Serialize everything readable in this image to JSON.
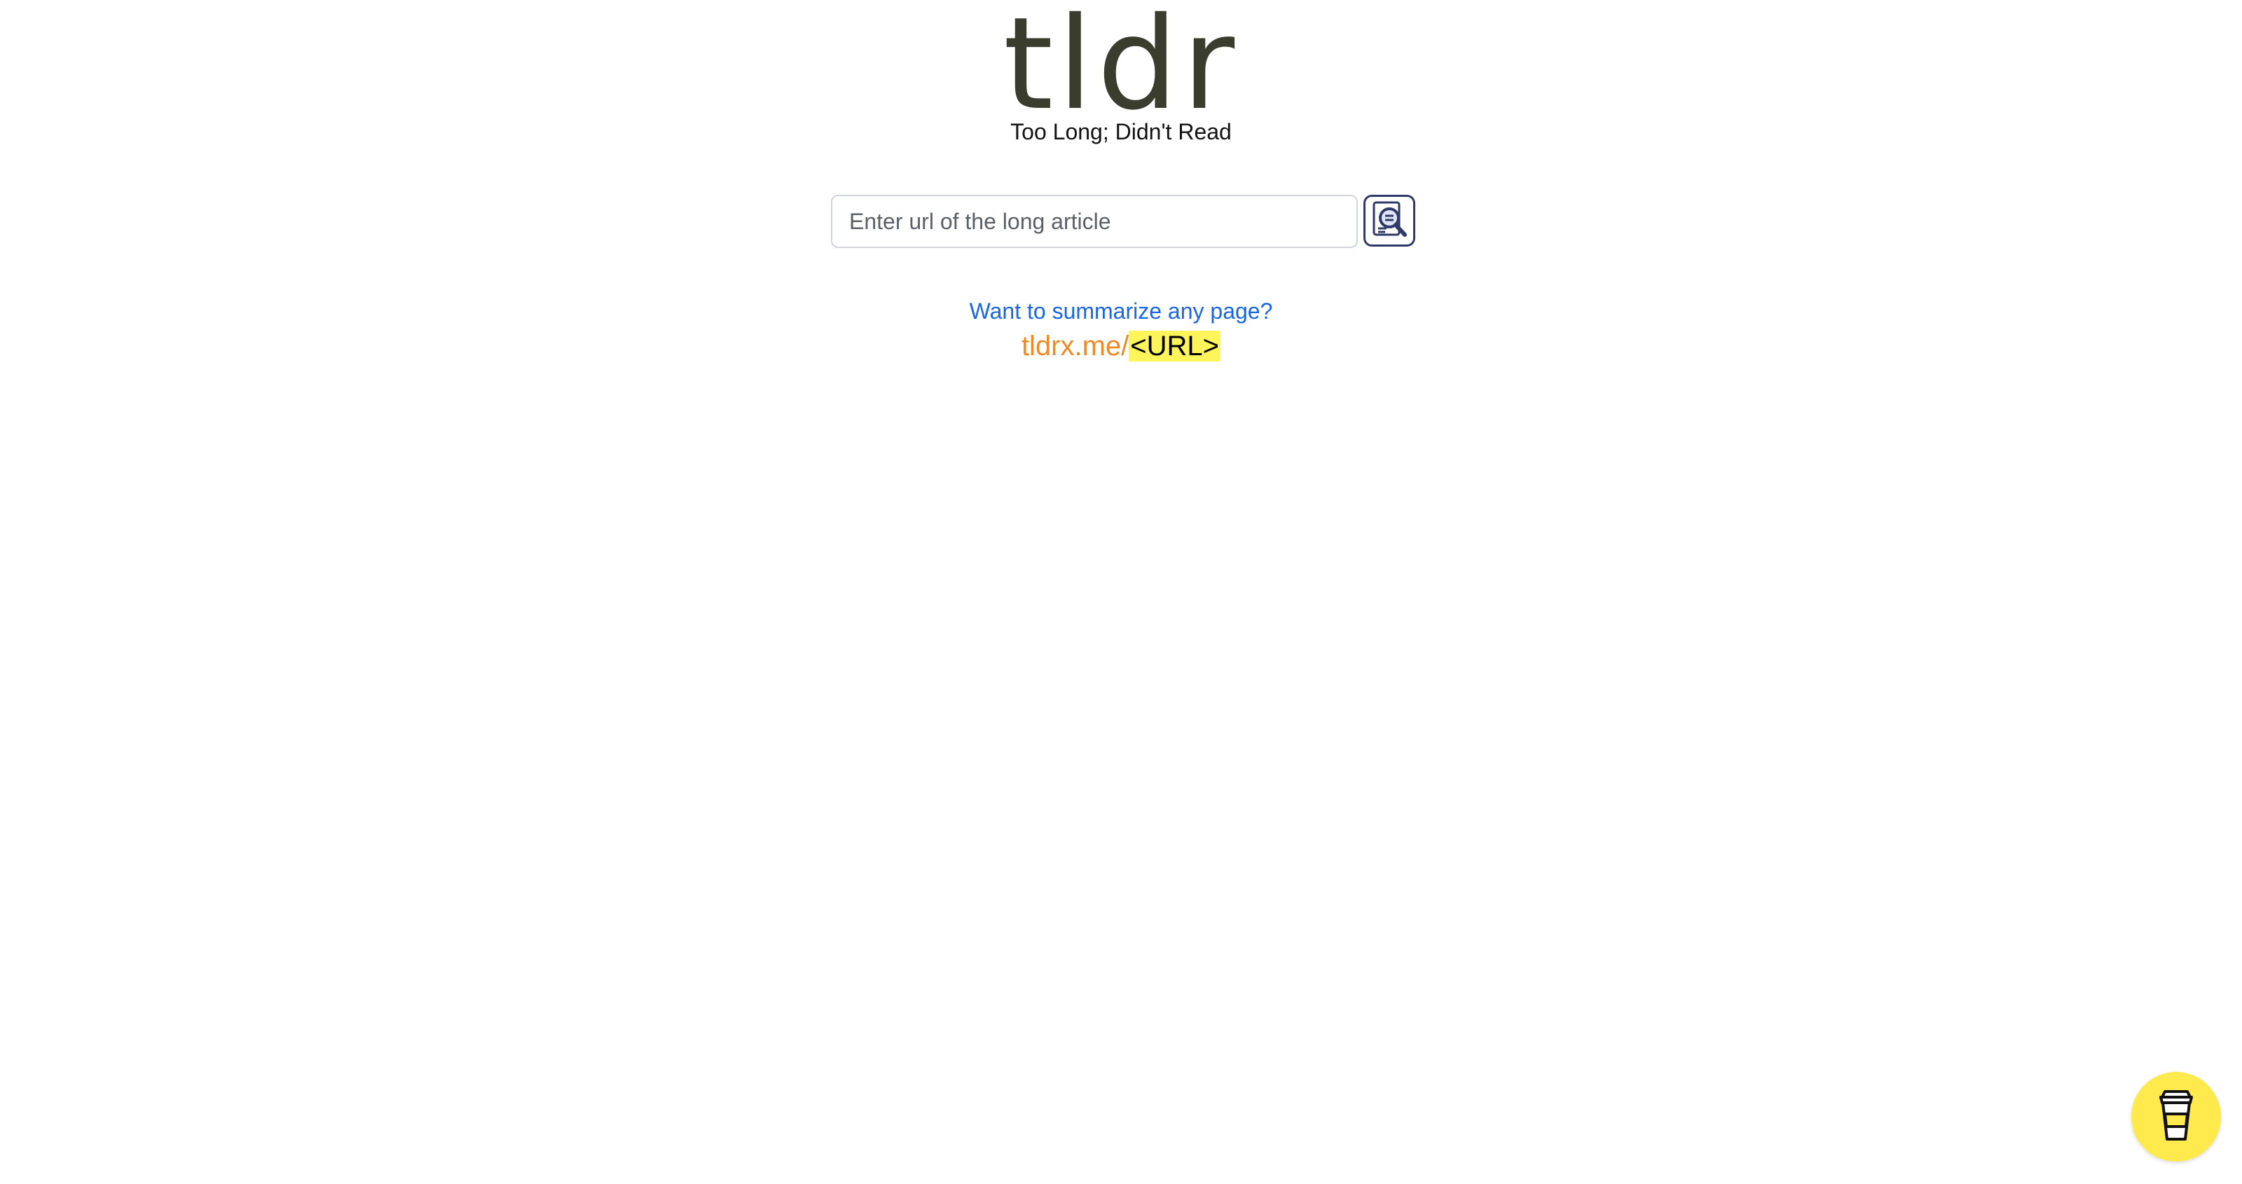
{
  "header": {
    "title": "tldr",
    "subtitle": "Too Long; Didn't Read"
  },
  "search": {
    "placeholder": "Enter url of the long article",
    "value": "",
    "button_icon": "document-search-icon"
  },
  "promo": {
    "question": "Want to summarize any page?",
    "url_prefix": "tldrx.me/",
    "url_placeholder": "<URL>"
  },
  "floating": {
    "icon": "coffee-cup-icon"
  },
  "colors": {
    "title": "#3a3d2e",
    "link": "#1a66e0",
    "domain": "#f08a24",
    "highlight": "#fff45a",
    "coffee_button": "#ffea4d",
    "search_button_border": "#2f3a6b"
  }
}
